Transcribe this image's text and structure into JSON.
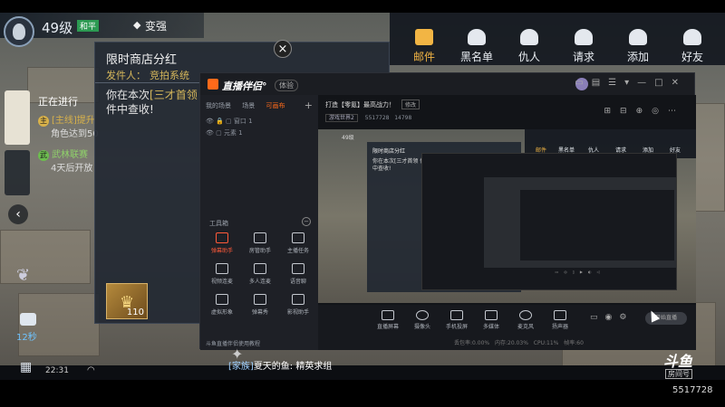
{
  "hud": {
    "level": "49级",
    "mode_badge": "和平",
    "strong_label": "变强"
  },
  "quest": {
    "heading": "正在进行",
    "items": [
      {
        "tag": "主",
        "title": "[主线]提升",
        "desc": "角色达到50"
      },
      {
        "tag": "武",
        "title": "武林联赛",
        "desc": "4天后开放"
      }
    ],
    "chat_count": "12秒",
    "time": "22:31"
  },
  "mail": {
    "title": "限时商店分红",
    "sender_label": "发件人：",
    "sender": "竞拍系统",
    "body_prefix": "你在本次",
    "body_highlight": "[三才首领",
    "body_suffix": "件中查收!",
    "item_count": "110"
  },
  "social": {
    "items": [
      {
        "label": "邮件",
        "icon": "mail-icon",
        "active": true
      },
      {
        "label": "黑名单",
        "icon": "blacklist-icon"
      },
      {
        "label": "仇人",
        "icon": "enemy-icon"
      },
      {
        "label": "请求",
        "icon": "request-icon"
      },
      {
        "label": "添加",
        "icon": "add-friend-icon"
      },
      {
        "label": "好友",
        "icon": "friends-icon"
      }
    ]
  },
  "companion": {
    "app_name": "直播伴侣°",
    "badge": "体验",
    "left_tabs": [
      "我的场景",
      "场景",
      "可画布"
    ],
    "sources": [
      "窗口 1",
      "元素 1"
    ],
    "tools_label": "工具箱",
    "tools": [
      {
        "label": "弹幕助手",
        "icon": "danmaku-icon",
        "hot": true
      },
      {
        "label": "房管助手",
        "icon": "manager-icon"
      },
      {
        "label": "主播任务",
        "icon": "task-icon"
      },
      {
        "label": "视频连麦",
        "icon": "video-link-icon"
      },
      {
        "label": "多人连麦",
        "icon": "multi-link-icon"
      },
      {
        "label": "语音聊",
        "icon": "voice-chat-icon"
      },
      {
        "label": "虚拟形象",
        "icon": "avatar-icon"
      },
      {
        "label": "弹幕秀",
        "icon": "danmaku-show-icon"
      },
      {
        "label": "影视助手",
        "icon": "movie-icon"
      }
    ],
    "footer_tip": "斗鱼直播伴侣使用教程",
    "room_title": "打造【零氪】最高战力！",
    "edit_label": "修改",
    "category": "游戏世界2",
    "room_id": "5517728",
    "heat": "14798",
    "bottom_tools": [
      {
        "label": "直播屏幕",
        "icon": "screen-icon"
      },
      {
        "label": "摄像头",
        "icon": "camera-icon"
      },
      {
        "label": "手机投屏",
        "icon": "phone-cast-icon"
      },
      {
        "label": "多媒体",
        "icon": "media-icon"
      },
      {
        "label": "麦克风",
        "icon": "mic-icon"
      },
      {
        "label": "扬声器",
        "icon": "speaker-icon"
      }
    ],
    "start_button": "开始直播",
    "status_line": "丢包率:0.00%  内存:20.03%  CPU:11%  帧率:60"
  },
  "preview": {
    "level": "49级",
    "mail_title": "限时商店分红",
    "mail_body": "你在本次[三才首领 件中查收!",
    "social_items": [
      "邮件",
      "黑名单",
      "仇人",
      "请求",
      "添加",
      "好友"
    ]
  },
  "bottom": {
    "clan_tag": "[家族]",
    "clan_message": "夏天的鱼: 精英求组"
  },
  "watermark": {
    "logo": "斗鱼",
    "sub": "房间号",
    "room_id": "5517728"
  }
}
